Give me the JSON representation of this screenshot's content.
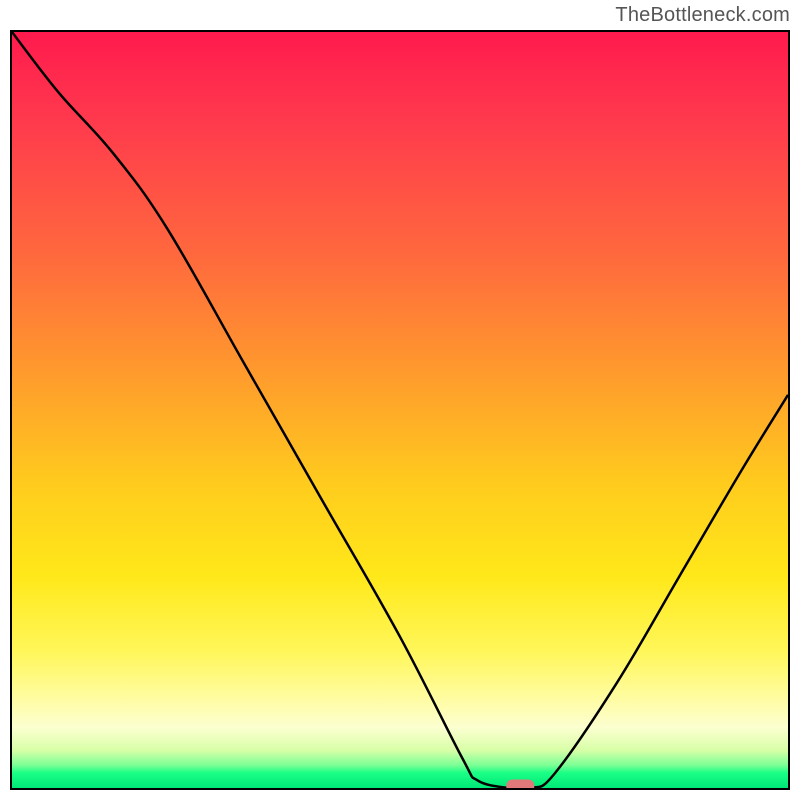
{
  "watermark": "TheBottleneck.com",
  "chart_data": {
    "type": "line",
    "title": "",
    "xlabel": "",
    "ylabel": "",
    "xlim": [
      0,
      100
    ],
    "ylim": [
      0,
      100
    ],
    "grid": false,
    "legend": false,
    "background_gradient": {
      "stops": [
        {
          "pos": 0,
          "color": "#ff1a4d"
        },
        {
          "pos": 30,
          "color": "#ff6a3d"
        },
        {
          "pos": 60,
          "color": "#ffcc1d"
        },
        {
          "pos": 88,
          "color": "#fffca0"
        },
        {
          "pos": 100,
          "color": "#00e878"
        }
      ],
      "meaning": "bottleneck severity (red=high, green=low)"
    },
    "series": [
      {
        "name": "bottleneck-curve",
        "x": [
          0,
          6,
          13,
          20,
          30,
          40,
          50,
          58,
          60,
          64,
          67,
          70,
          78,
          86,
          94,
          100
        ],
        "y": [
          100,
          92,
          84,
          74,
          56,
          38,
          20,
          4,
          1,
          0,
          0,
          2,
          14,
          28,
          42,
          52
        ]
      }
    ],
    "marker": {
      "name": "optimal-point",
      "x": 65.5,
      "y": 0,
      "shape": "capsule",
      "color": "#e07a7a"
    }
  }
}
